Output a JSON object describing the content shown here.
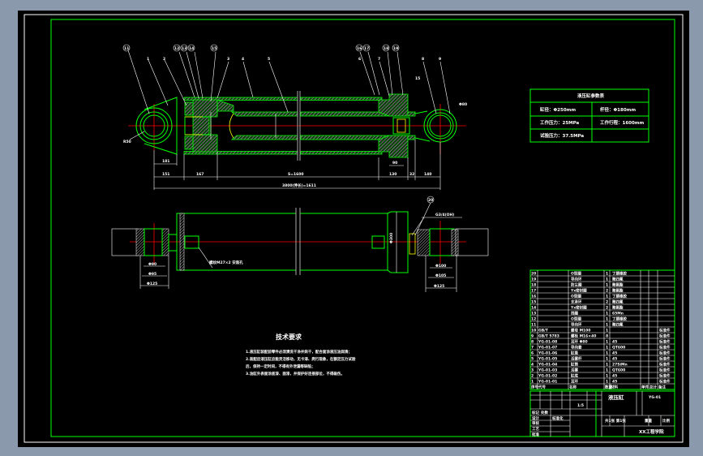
{
  "colors": {
    "background": "#8a99ab",
    "sheet": "#000000",
    "frame": "#00ff00",
    "line": "#ffffff",
    "centerline": "#ff0000",
    "hatch": "#00ff00"
  },
  "balloons": {
    "top": [
      "11",
      "12",
      "13",
      "14",
      "15",
      "16",
      "17",
      "18",
      "19"
    ],
    "bottom": "20"
  },
  "part_labels": [
    "1",
    "2",
    "3",
    "4",
    "5",
    "6",
    "7",
    "8",
    "9"
  ],
  "dims": {
    "top": [
      "151",
      "167",
      "S=1600",
      "130",
      "32",
      "140"
    ],
    "overall": "3800(伸长)=1611",
    "misc": [
      "Φ80",
      "R50",
      "181",
      "90",
      "15"
    ],
    "bottom": {
      "left": [
        "Φ90",
        "Φ95",
        "Φ125"
      ],
      "right": [
        "Φ100",
        "Φ105",
        "Φ125"
      ],
      "port_left": "螺纹M27×2\n安装孔",
      "port_right": "G3/4(OH)",
      "head": "Φ300"
    }
  },
  "params": {
    "title": "液压缸参数表",
    "rows": [
      [
        "缸径：Φ250mm",
        "杆径：Φ180mm"
      ],
      [
        "工作压力：25MPa",
        "工作行程：1600mm"
      ],
      [
        "试验压力：37.5MPa",
        ""
      ]
    ]
  },
  "tech": {
    "title": "技术要求",
    "lines": [
      "1.液压缸装配前零件必须清洗干净并烘干，配合面涂液压油润滑；",
      "2.装配后液压缸应能灵活移动，无卡滞、爬行现象，在额定压力试验",
      "  后，保持一定时间，不得有外泄漏等缺陷；",
      "3.油缸外表面涂底漆、面漆，并保护好连接部位，不得碰伤。"
    ]
  },
  "parts": {
    "rows": [
      [
        "20",
        "",
        "O型圈",
        "1",
        "丁腈橡胶",
        ""
      ],
      [
        "19",
        "",
        "导向环",
        "1",
        "聚四氟",
        ""
      ],
      [
        "18",
        "",
        "防尘圈",
        "1",
        "聚氨酯",
        ""
      ],
      [
        "17",
        "",
        "Yx密封圈",
        "2",
        "聚氨酯",
        ""
      ],
      [
        "16",
        "",
        "O型圈",
        "1",
        "丁腈橡胶",
        ""
      ],
      [
        "15",
        "",
        "支承环",
        "2",
        "聚四氟",
        ""
      ],
      [
        "14",
        "",
        "Yx密封圈",
        "2",
        "聚氨酯",
        ""
      ],
      [
        "13",
        "",
        "挡圈",
        "1",
        "65Mn",
        ""
      ],
      [
        "12",
        "",
        "O型圈",
        "1",
        "丁腈橡胶",
        ""
      ],
      [
        "11",
        "",
        "导向环",
        "1",
        "聚四氟",
        ""
      ],
      [
        "10",
        "GB/T",
        "螺母 M100",
        "1",
        "",
        "标准件"
      ],
      [
        "9",
        "GB/T 5783",
        "螺栓 M16×40",
        "8",
        "",
        "标准件"
      ],
      [
        "8",
        "YG-01-08",
        "耳环 Φ80",
        "1",
        "45",
        "标准件"
      ],
      [
        "7",
        "YG-01-07",
        "导向套",
        "1",
        "QT600",
        "标准件"
      ],
      [
        "6",
        "YG-01-06",
        "缸盖",
        "1",
        "45",
        "标准件"
      ],
      [
        "5",
        "YG-01-05",
        "活塞杆",
        "1",
        "45",
        "标准件"
      ],
      [
        "4",
        "YG-01-04",
        "缸筒",
        "1",
        "27SiMn",
        "标准件"
      ],
      [
        "3",
        "YG-01-03",
        "活塞",
        "1",
        "QT600",
        "标准件"
      ],
      [
        "2",
        "YG-01-02",
        "缸底",
        "1",
        "45",
        "标准件"
      ],
      [
        "1",
        "YG-01-01",
        "耳环",
        "1",
        "45",
        "标准件"
      ]
    ],
    "header": [
      "序号",
      "代号",
      "名称",
      "数量",
      "材料",
      "单件",
      "总计",
      "备注"
    ]
  },
  "title_block": {
    "name": "液压缸",
    "code": "YG-01",
    "scale": "1:5",
    "school": "XX工程学院",
    "sheet": "共1张 第1张",
    "labels": [
      "标记",
      "处数",
      "分区",
      "更改文件号",
      "签名",
      "年月日",
      "设计",
      "审核",
      "工艺",
      "批准",
      "标准化",
      "阶段标记",
      "重量",
      "比例"
    ]
  }
}
